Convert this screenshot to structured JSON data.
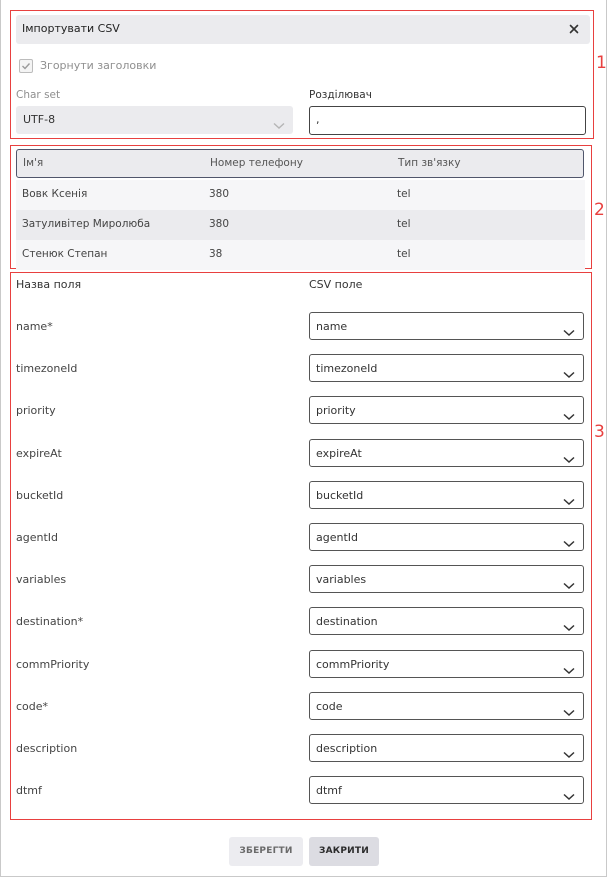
{
  "dialog": {
    "title": "Імпортувати CSV",
    "close_icon": "close-icon",
    "collapse_headers": {
      "label": "Згорнути заголовки",
      "checked": true
    },
    "charset": {
      "label": "Char set",
      "value": "UTF-8"
    },
    "delimiter": {
      "label": "Розділювач",
      "value": ","
    }
  },
  "preview": {
    "headers": [
      "Ім'я",
      "Номер телефону",
      "Тип зв'язку"
    ],
    "rows": [
      [
        "Вовк Ксенія",
        "380",
        "tel"
      ],
      [
        "Затуливітер Миролюба",
        "380",
        "tel"
      ],
      [
        "Стенюк Степан",
        "38",
        "tel"
      ]
    ]
  },
  "mapping": {
    "field_column_title": "Назва поля",
    "csv_column_title": "CSV поле",
    "fields": [
      {
        "name": "name*",
        "csv": "name"
      },
      {
        "name": "timezoneId",
        "csv": "timezoneId"
      },
      {
        "name": "priority",
        "csv": "priority"
      },
      {
        "name": "expireAt",
        "csv": "expireAt"
      },
      {
        "name": "bucketId",
        "csv": "bucketId"
      },
      {
        "name": "agentId",
        "csv": "agentId"
      },
      {
        "name": "variables",
        "csv": "variables"
      },
      {
        "name": "destination*",
        "csv": "destination"
      },
      {
        "name": "commPriority",
        "csv": "commPriority"
      },
      {
        "name": "code*",
        "csv": "code"
      },
      {
        "name": "description",
        "csv": "description"
      },
      {
        "name": "dtmf",
        "csv": "dtmf"
      }
    ]
  },
  "footer": {
    "save_label": "ЗБЕРЕГТИ",
    "close_label": "ЗАКРИТИ"
  },
  "annotations": {
    "section1": "1",
    "section2": "2",
    "section3": "3"
  },
  "colors": {
    "annotation": "#e8403f",
    "panel": "#ebebee",
    "border": "#50566b"
  }
}
